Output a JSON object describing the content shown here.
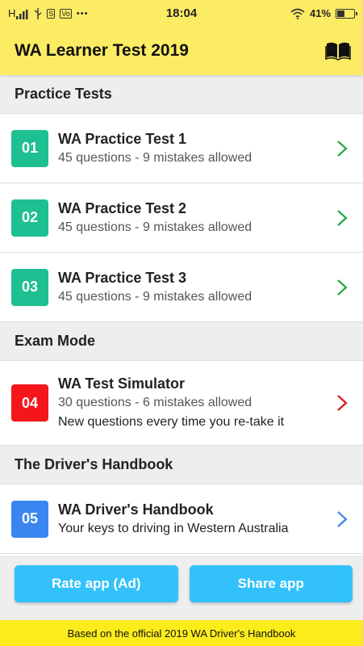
{
  "status_bar": {
    "left_signal": "H",
    "sim_label": "S",
    "volte_label": "Vo",
    "dots": "•••",
    "time": "18:04",
    "battery_percent": "41%",
    "battery_level": 0.41
  },
  "app_bar": {
    "title": "WA Learner Test 2019",
    "icon": "book-open-icon"
  },
  "sections": {
    "practice": "Practice Tests",
    "exam": "Exam Mode",
    "handbook": "The Driver's Handbook"
  },
  "items": [
    {
      "badge": "01",
      "title": "WA Practice Test 1",
      "subtitle": "45 questions - 9 mistakes allowed",
      "color": "#1ec091",
      "chevron_color": "#22a845"
    },
    {
      "badge": "02",
      "title": "WA Practice Test 2",
      "subtitle": "45 questions - 9 mistakes allowed",
      "color": "#1ec091",
      "chevron_color": "#22a845"
    },
    {
      "badge": "03",
      "title": "WA Practice Test 3",
      "subtitle": "45 questions - 9 mistakes allowed",
      "color": "#1ec091",
      "chevron_color": "#22a845"
    },
    {
      "badge": "04",
      "title": "WA Test Simulator",
      "subtitle": "30 questions - 6 mistakes allowed",
      "subtitle2": "New questions every time you re-take it",
      "color": "#f4161a",
      "chevron_color": "#e0151a"
    },
    {
      "badge": "05",
      "title": "WA Driver's Handbook",
      "subtitle": "Your keys to driving in Western Australia",
      "color": "#3a86f0",
      "chevron_color": "#3a86f0"
    }
  ],
  "buttons": {
    "rate": "Rate app (Ad)",
    "share": "Share app",
    "color": "#33c1fb"
  },
  "footer": "Based on the official 2019 WA Driver's Handbook",
  "colors": {
    "brand_yellow": "#fcec64",
    "footer_yellow": "#fcec1c",
    "section_gray": "#eeeeee"
  }
}
